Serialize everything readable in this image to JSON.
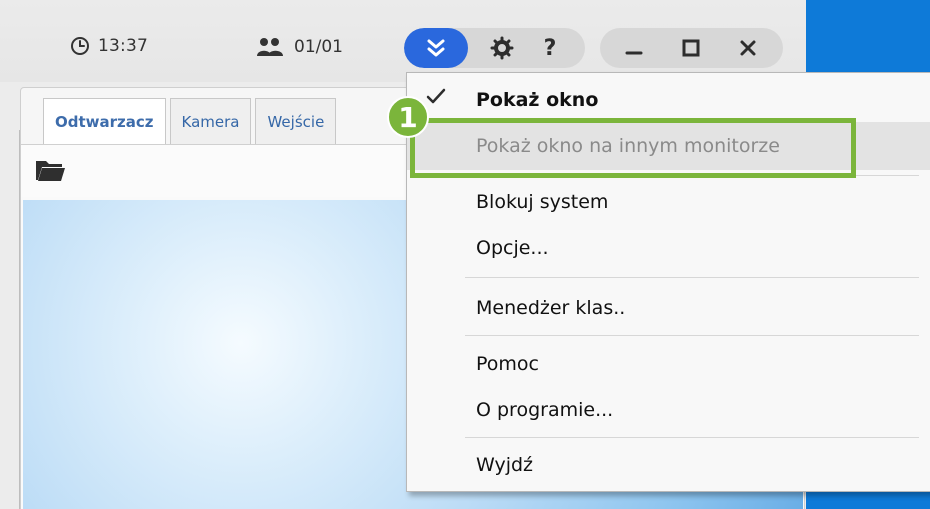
{
  "titlebar": {
    "time": "13:37",
    "users_count": "01/01",
    "icons": {
      "clock": "clock-icon",
      "users": "users-icon",
      "expand": "double-chevron-down-icon",
      "settings": "gear-icon",
      "help": "help-icon",
      "minimize": "minimize-icon",
      "maximize": "maximize-icon",
      "close": "close-icon"
    },
    "help_label": "?"
  },
  "tabs": [
    {
      "label": "Odtwarzacz",
      "active": true
    },
    {
      "label": "Kamera",
      "active": false
    },
    {
      "label": "Wejście",
      "active": false
    }
  ],
  "toolbar": {
    "open_folder_icon": "open-folder-icon"
  },
  "menu": {
    "items": [
      {
        "label": "Pokaż okno",
        "checked": true,
        "style": "bold"
      },
      {
        "label": "Pokaż okno na innym monitorze",
        "disabled": true
      },
      {
        "label": "Blokuj system"
      },
      {
        "label": "Opcje..."
      },
      {
        "label": "Menedżer klas.."
      },
      {
        "label": "Pomoc"
      },
      {
        "label": "O programie..."
      },
      {
        "label": "Wyjdź"
      }
    ]
  },
  "annotation": {
    "step_number": "1"
  },
  "colors": {
    "accent_blue": "#2a68dd",
    "highlight_green": "#7bb53b",
    "tab_text": "#3567a7",
    "desktop_blue": "#0e7ad8"
  }
}
